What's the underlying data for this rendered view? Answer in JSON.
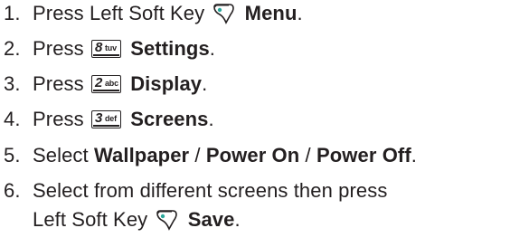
{
  "steps": [
    {
      "number": "1.",
      "text_before": "Press Left Soft Key",
      "icon": "left-soft-key-icon",
      "bold": "Menu",
      "after": "."
    },
    {
      "number": "2.",
      "text_before": "Press",
      "key": {
        "digit": "8",
        "letters": "tuv"
      },
      "bold": "Settings",
      "after": "."
    },
    {
      "number": "3.",
      "text_before": "Press",
      "key": {
        "digit": "2",
        "letters": "abc"
      },
      "bold": "Display",
      "after": "."
    },
    {
      "number": "4.",
      "text_before": "Press",
      "key": {
        "digit": "3",
        "letters": "def"
      },
      "bold": "Screens",
      "after": "."
    },
    {
      "number": "5.",
      "text_before": "Select",
      "options": [
        "Wallpaper",
        "Power On",
        "Power Off"
      ],
      "separator": " / ",
      "after": "."
    },
    {
      "number": "6.",
      "line1": "Select from different screens then press",
      "line2_before": "Left Soft Key",
      "icon": "left-soft-key-icon",
      "bold": "Save",
      "after": "."
    }
  ]
}
